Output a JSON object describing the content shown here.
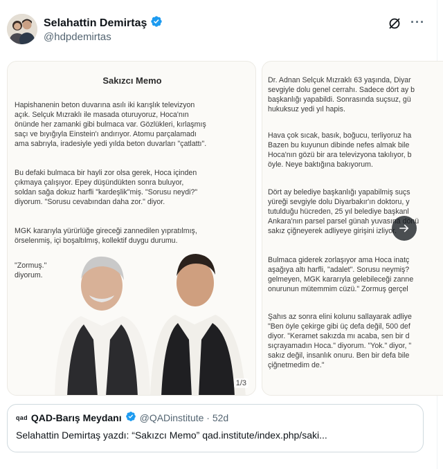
{
  "author": {
    "display_name": "Selahattin Demirtaş",
    "handle": "@hdpdemirtas",
    "verified": true
  },
  "header_icons": {
    "grok": "grok-icon",
    "more": "more-icon"
  },
  "card1": {
    "title": "Sakızcı Memo",
    "paragraphs": [
      "Hapishanenin beton duvarına asılı iki karışlık televizyon\naçık. Selçuk Mızraklı ile masada oturuyoruz, Hoca'nın\nönünde her zamanki gibi bulmaca var. Gözlükleri, kırlaşmış\nsaçı ve bıyığıyla Einstein'ı andırıyor. Atomu parçalamadı\nama sabrıyla, iradesiyle yedi yılda beton duvarları \"çatlattı\".",
      "Bu defaki bulmaca bir hayli zor olsa gerek, Hoca içinden\nçıkmaya çalışıyor. Epey düşündükten sonra buluyor,\nsoldan sağa dokuz harfli \"kardeşlik\"miş. \"Sorusu neydi?\"\ndiyorum. \"Sorusu cevabından daha zor.\" diyor.",
      "MGK kararıyla yürürlüğe gireceği zannedilen yıpratılmış,\nörselenmiş, içi boşaltılmış, kollektif duygu durumu.",
      "\"Zormuş.\"\ndiyorum."
    ],
    "counter": "1/3"
  },
  "card2": {
    "paragraphs": [
      "Dr. Adnan Selçuk Mızraklı 63 yaşında, Diyar\nsevgiyle dolu genel cerrahı. Sadece dört ay b\nbaşkanlığı yapabildi. Sonrasında suçsuz, gü\nhukuksuz yedi yıl hapis.",
      "Hava çok sıcak, basık, boğucu, terliyoruz ha\nBazen bu kuyunun dibinde nefes almak bile\nHoca'nın gözü bir ara televizyona takılıyor, b\nöyle. Neye baktığına bakıyorum.",
      "Dört ay belediye başkanlığı yapabilmiş suçs\nyüreği sevgiyle dolu Diyarbakır'ın doktoru, y\ntutulduğu hücreden, 25 yıl belediye başkanl\nAnkara'nın parsel parsel günah yuvasına dönü\nsakız çiğneyerek adliyeye girişini izliyor.",
      "Bulmaca giderek zorlaşıyor ama Hoca inatç\naşağıya altı harfli, \"adalet\". Sorusu neymiş?\ngelmeyen, MGK kararıyla gelebileceği zanne\nonurunun mütemmim cüzü.\" Zormuş gerçel",
      "Şahıs az sonra elini kolunu sallayarak adliye\n\"Ben öyle çekirge gibi üç defa değil, 500 def\ndiyor. \"Keramet sakızda mı acaba, sen bir d\nsıçrayamadın Hoca.\" diyorum. \"Yok.\" diyor, \"\nsakız değil, insanlık onuru. Ben bir defa bile\nçiğnetmedim de.\""
    ]
  },
  "next_button_icon": "arrow-right-icon",
  "quote": {
    "logo_text": "qad",
    "name": "QAD-Barış Meydanı",
    "verified": true,
    "meta": "@QADinstitute · 52d",
    "text": "Selahattin Demirtaş yazdı: “Sakızcı Memo” qad.institute/index.php/saki..."
  },
  "colors": {
    "verified_blue": "#1d9bf0",
    "text_primary": "#0f1419",
    "text_secondary": "#536471",
    "border": "#cfd9de"
  }
}
